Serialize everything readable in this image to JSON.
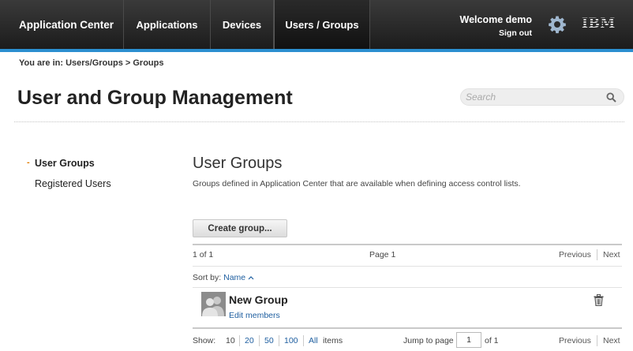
{
  "header": {
    "brand": "Application Center",
    "nav": {
      "applications": "Applications",
      "devices": "Devices",
      "users_groups": "Users / Groups"
    },
    "welcome": "Welcome demo",
    "sign_out": "Sign out",
    "logo_text": "IBM"
  },
  "breadcrumb": "You are in: Users/Groups > Groups",
  "page": {
    "title": "User and Group Management",
    "search_placeholder": "Search"
  },
  "sidebar": {
    "items": [
      {
        "label": "User Groups",
        "active": true
      },
      {
        "label": "Registered Users",
        "active": false
      }
    ]
  },
  "main": {
    "section_title": "User Groups",
    "description": "Groups defined in Application Center that are available when defining access control lists.",
    "create_button": "Create group...",
    "pager": {
      "count": "1 of 1",
      "page_label": "Page 1",
      "previous": "Previous",
      "next": "Next"
    },
    "sort": {
      "label": "Sort by:",
      "field": "Name"
    },
    "groups": [
      {
        "name": "New Group",
        "action": "Edit members"
      }
    ],
    "footer": {
      "show_label": "Show:",
      "page_sizes": [
        "10",
        "20",
        "50",
        "100",
        "All"
      ],
      "items_label": "items",
      "jump_label": "Jump to page",
      "jump_value": "1",
      "of_label": "of 1",
      "previous": "Previous",
      "next": "Next"
    }
  },
  "colors": {
    "accent": "#2b8fd0",
    "link": "#1f5fa0",
    "active_bullet": "#e07b00"
  }
}
